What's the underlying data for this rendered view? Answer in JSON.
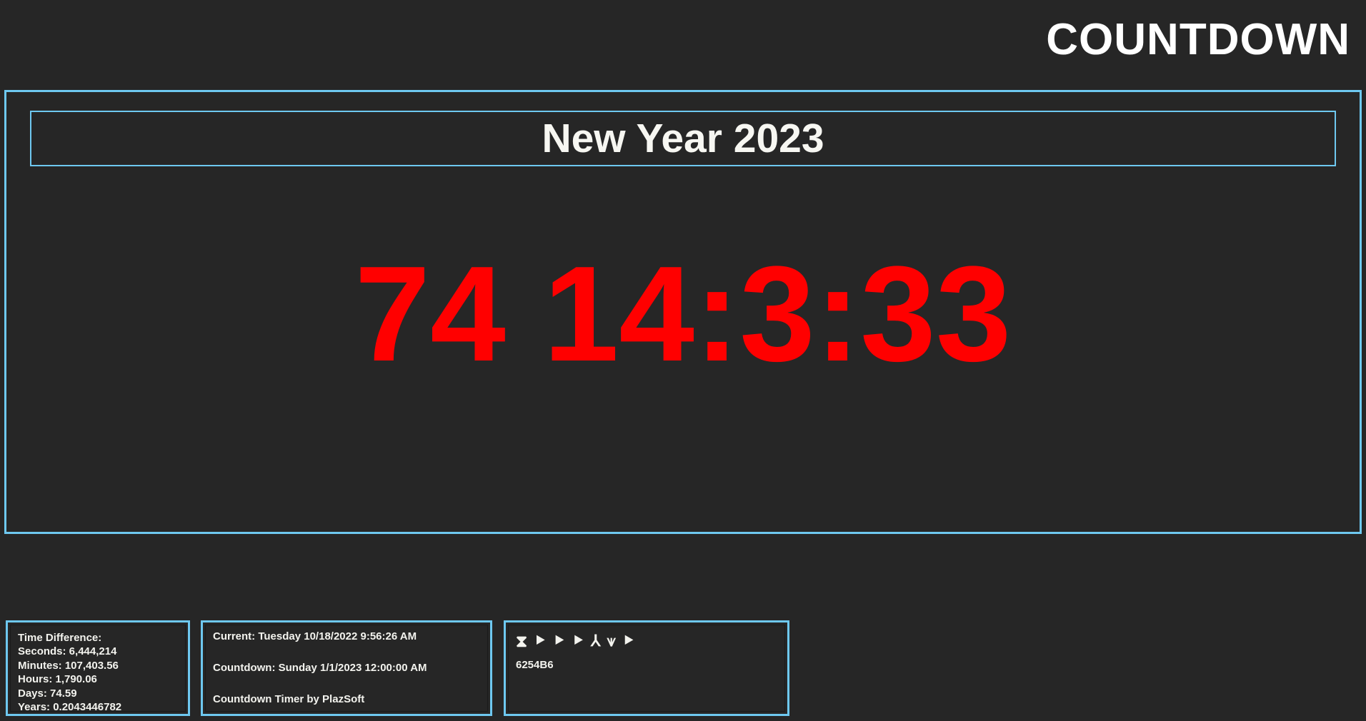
{
  "app": {
    "title": "COUNTDOWN"
  },
  "display": {
    "event_title": "New Year 2023",
    "countdown_value": "74 14:3:33",
    "countdown_color": "#FF0000",
    "frame_border_color": "#6EC8F0",
    "background_color": "#262626"
  },
  "time_difference_panel": {
    "heading": "Time Difference:",
    "rows": [
      {
        "label": "Seconds:",
        "value": "6,444,214",
        "text": "Seconds: 6,444,214"
      },
      {
        "label": "Minutes:",
        "value": "107,403.56",
        "text": "Minutes: 107,403.56"
      },
      {
        "label": "Hours:",
        "value": "1,790.06",
        "text": "Hours: 1,790.06"
      },
      {
        "label": "Days:",
        "value": "74.59",
        "text": "Days: 74.59"
      },
      {
        "label": "Years:",
        "value": "0.2043446782",
        "text": "Years: 0.2043446782"
      }
    ]
  },
  "times_panel": {
    "current": "Current: Tuesday 10/18/2022 9:56:26 AM",
    "countdown_target": "Countdown: Sunday 1/1/2023 12:00:00 AM",
    "credit": "Countdown Timer by PlazSoft"
  },
  "symbols_panel": {
    "glyphs": [
      {
        "name": "hourglass-icon",
        "char": "⧗"
      },
      {
        "name": "chevron-left-icon-1",
        "char": "⯈"
      },
      {
        "name": "chevron-left-icon-2",
        "char": "⯈"
      },
      {
        "name": "chevron-left-icon-3",
        "char": "⯈"
      },
      {
        "name": "y-fork-icon",
        "char": "⅄"
      },
      {
        "name": "w-zigzag-icon",
        "char": "⩛"
      },
      {
        "name": "chevron-left-icon-4",
        "char": "⯈"
      }
    ],
    "code": "6254B6"
  }
}
